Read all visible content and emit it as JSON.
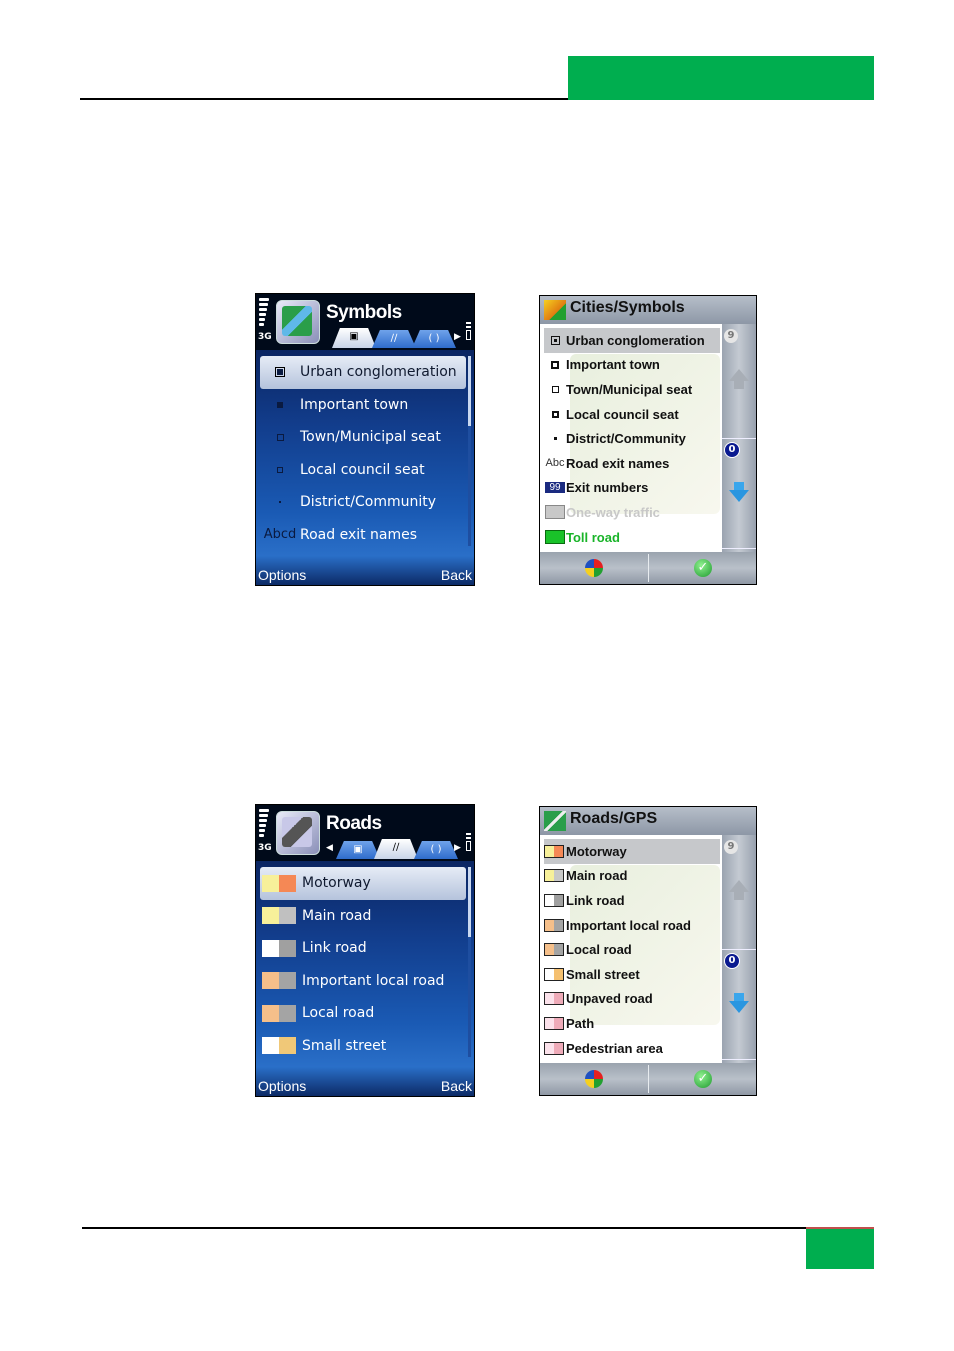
{
  "page": {
    "accent_color": "#00ae4f",
    "rule_color": "#000000",
    "footer_accent_line": "#c0504d"
  },
  "screens": {
    "symbols_phone": {
      "network": "3G",
      "title": "Symbols",
      "icon": "map-app-icon",
      "tabs": [
        {
          "icon": "symbol-tab-icon",
          "active": true
        },
        {
          "icon": "road-tab-icon",
          "active": false
        },
        {
          "icon": "other-tab-icon",
          "active": false
        }
      ],
      "items": [
        {
          "icon": "filled-square-large",
          "label": "Urban conglomeration",
          "selected": true
        },
        {
          "icon": "filled-square-medium",
          "label": "Important town",
          "selected": false
        },
        {
          "icon": "hollow-square-small",
          "label": "Town/Municipal seat",
          "selected": false
        },
        {
          "icon": "hollow-square-tiny",
          "label": "Local council seat",
          "selected": false
        },
        {
          "icon": "dot",
          "label": "District/Community",
          "selected": false
        },
        {
          "icon_text": "Abcd",
          "label": "Road exit names",
          "selected": false
        }
      ],
      "softkeys": {
        "left": "Options",
        "right": "Back"
      }
    },
    "cities_symbols": {
      "title": "Cities/Symbols",
      "items": [
        {
          "icon": "square-dot",
          "label": "Urban conglomeration",
          "selected": true,
          "color": "#111111"
        },
        {
          "icon": "square-dot-thick",
          "label": "Important town",
          "selected": false,
          "color": "#111111"
        },
        {
          "icon": "square-hollow",
          "label": "Town/Municipal seat",
          "selected": false,
          "color": "#111111"
        },
        {
          "icon": "square-thick",
          "label": "Local council seat",
          "selected": false,
          "color": "#111111"
        },
        {
          "icon": "small-dot",
          "label": "District/Community",
          "selected": false,
          "color": "#111111"
        },
        {
          "icon_text": "Abc",
          "label": "Road exit names",
          "selected": false,
          "color": "#111111"
        },
        {
          "icon_text": "99",
          "label": "Exit numbers",
          "selected": false,
          "color": "#111111"
        },
        {
          "swatch": "#c8c8c8",
          "label": "One-way traffic",
          "selected": false,
          "color": "#c8c8c8"
        },
        {
          "swatch": "#19c229",
          "label": "Toll road",
          "selected": false,
          "color": "#19b429"
        }
      ],
      "side": {
        "top_number": "9",
        "bottom_number": "0"
      },
      "footer": {
        "left_icon": "color-ball-icon",
        "right_icon": "check-icon"
      }
    },
    "roads_phone": {
      "network": "3G",
      "title": "Roads",
      "icon": "road-app-icon",
      "tabs": [
        {
          "icon": "symbol-tab-icon",
          "active": false
        },
        {
          "icon": "road-tab-icon",
          "active": true
        },
        {
          "icon": "other-tab-icon",
          "active": false
        }
      ],
      "items": [
        {
          "label": "Motorway",
          "fill": "#f7f09a",
          "border": "#f58855",
          "selected": true
        },
        {
          "label": "Main road",
          "fill": "#f7f09a",
          "border": "#c0c0c0",
          "selected": false
        },
        {
          "label": "Link road",
          "fill": "#ffffff",
          "border": "#a0a0a0",
          "selected": false
        },
        {
          "label": "Important local road",
          "fill": "#f5bf8a",
          "border": "#a4a4a4",
          "selected": false
        },
        {
          "label": "Local road",
          "fill": "#f5bf8a",
          "border": "#a4a4a4",
          "selected": false
        },
        {
          "label": "Small street",
          "fill": "#ffffff",
          "border": "#f0c878",
          "selected": false
        }
      ],
      "softkeys": {
        "left": "Options",
        "right": "Back"
      }
    },
    "roads_gps": {
      "title": "Roads/GPS",
      "items": [
        {
          "label": "Motorway",
          "fill": "#f7f09a",
          "border": "#f58855",
          "selected": true
        },
        {
          "label": "Main road",
          "fill": "#f7f09a",
          "border": "#c8c8c8",
          "selected": false
        },
        {
          "label": "Link road",
          "fill": "#ffffff",
          "border": "#a0a0a0",
          "selected": false
        },
        {
          "label": "Important local road",
          "fill": "#f5bf8a",
          "border": "#a4a4a4",
          "selected": false
        },
        {
          "label": "Local road",
          "fill": "#f5bf8a",
          "border": "#a4a4a4",
          "selected": false
        },
        {
          "label": "Small street",
          "fill": "#ffffff",
          "border": "#f5c070",
          "selected": false
        },
        {
          "label": "Unpaved road",
          "fill": "#fbe1ea",
          "border": "#eeaab8",
          "selected": false
        },
        {
          "label": "Path",
          "fill": "#fbe1ea",
          "border": "#eeaab8",
          "selected": false
        },
        {
          "label": "Pedestrian area",
          "fill": "#fbe1ea",
          "border": "#eeaab8",
          "selected": false
        }
      ],
      "side": {
        "top_number": "9",
        "bottom_number": "0"
      },
      "footer": {
        "left_icon": "color-ball-icon",
        "right_icon": "check-icon"
      }
    }
  }
}
